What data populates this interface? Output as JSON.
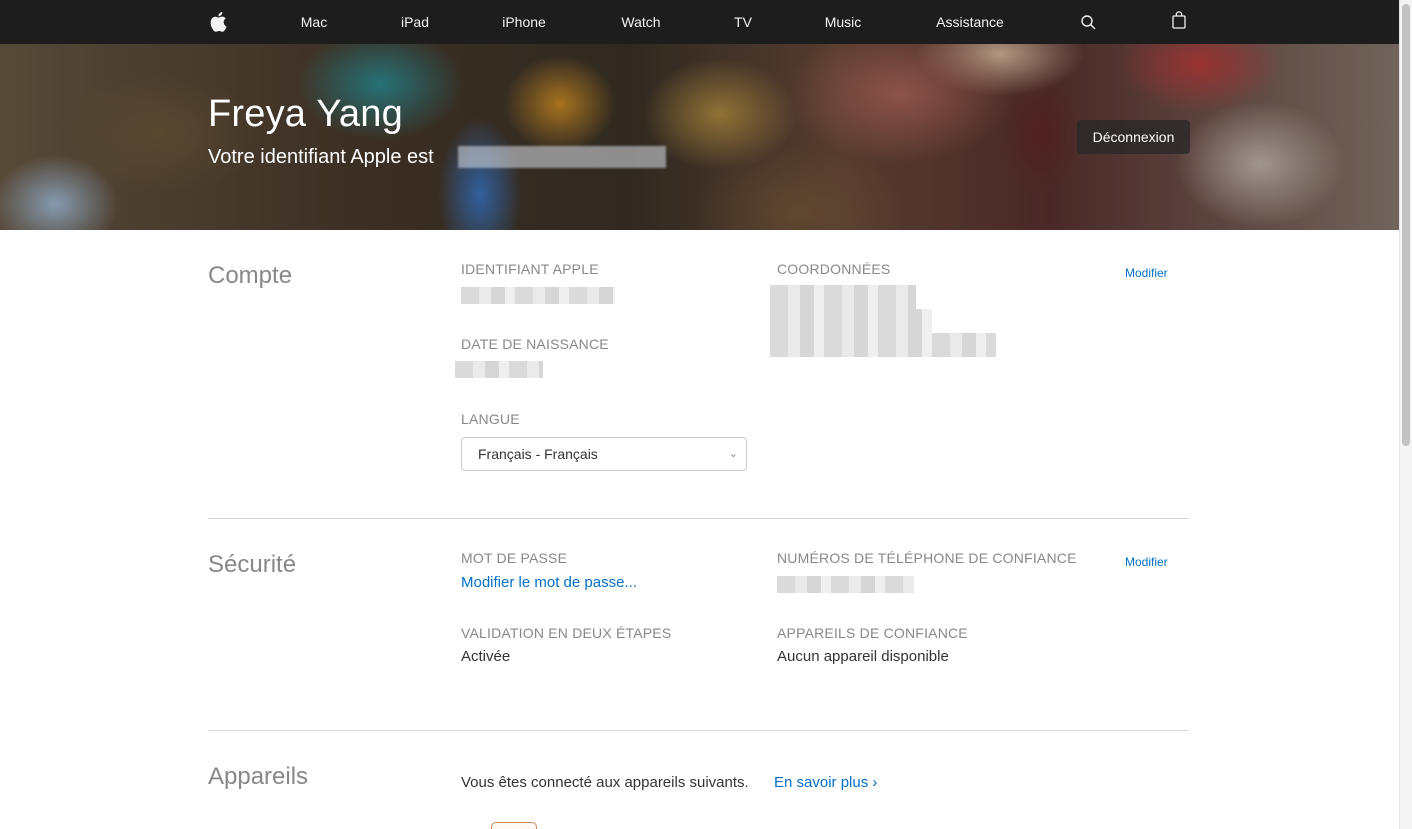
{
  "nav": {
    "items": [
      "Mac",
      "iPad",
      "iPhone",
      "Watch",
      "TV",
      "Music",
      "Assistance"
    ],
    "icons": [
      "apple-logo-icon",
      "search-icon",
      "bag-icon"
    ]
  },
  "hero": {
    "name": "Freya Yang",
    "subtitle": "Votre identifiant Apple est",
    "logout_label": "Déconnexion"
  },
  "account": {
    "title": "Compte",
    "apple_id_label": "IDENTIFIANT APPLE",
    "birthdate_label": "DATE DE NAISSANCE",
    "language_label": "LANGUE",
    "language_value": "Français - Français",
    "contact_label": "COORDONNÉES",
    "edit_label": "Modifier"
  },
  "security": {
    "title": "Sécurité",
    "password_label": "MOT DE PASSE",
    "password_link": "Modifier le mot de passe...",
    "two_step_label": "VALIDATION EN DEUX ÉTAPES",
    "two_step_value": "Activée",
    "trusted_phones_label": "NUMÉROS DE TÉLÉPHONE DE CONFIANCE",
    "trusted_devices_label": "APPAREILS DE CONFIANCE",
    "trusted_devices_value": "Aucun appareil disponible",
    "edit_label": "Modifier"
  },
  "devices": {
    "title": "Appareils",
    "intro": "Vous êtes connecté aux appareils suivants.",
    "learn_more": "En savoir plus ›"
  }
}
